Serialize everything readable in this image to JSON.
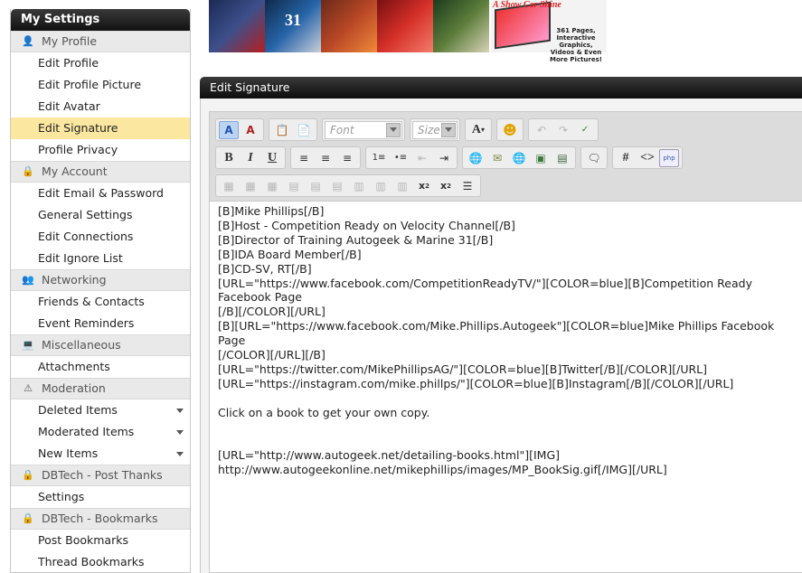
{
  "sidebar": {
    "title": "My Settings",
    "sections": [
      {
        "label": "My Profile",
        "icon": "user-icon",
        "items": [
          {
            "label": "Edit Profile"
          },
          {
            "label": "Edit Profile Picture"
          },
          {
            "label": "Edit Avatar"
          },
          {
            "label": "Edit Signature",
            "active": true
          },
          {
            "label": "Profile Privacy"
          }
        ]
      },
      {
        "label": "My Account",
        "icon": "lock-icon",
        "items": [
          {
            "label": "Edit Email & Password"
          },
          {
            "label": "General Settings"
          },
          {
            "label": "Edit Connections"
          },
          {
            "label": "Edit Ignore List"
          }
        ]
      },
      {
        "label": "Networking",
        "icon": "people-icon",
        "items": [
          {
            "label": "Friends & Contacts"
          },
          {
            "label": "Event Reminders"
          }
        ]
      },
      {
        "label": "Miscellaneous",
        "icon": "monitor-icon",
        "items": [
          {
            "label": "Attachments"
          }
        ]
      },
      {
        "label": "Moderation",
        "icon": "warning-icon",
        "items": [
          {
            "label": "Deleted Items",
            "dropdown": true
          },
          {
            "label": "Moderated Items",
            "dropdown": true
          },
          {
            "label": "New Items",
            "dropdown": true
          }
        ]
      },
      {
        "label": "DBTech - Post Thanks",
        "icon": "lock-icon",
        "items": [
          {
            "label": "Settings"
          }
        ]
      },
      {
        "label": "DBTech - Bookmarks",
        "icon": "lock-icon",
        "items": [
          {
            "label": "Post Bookmarks"
          },
          {
            "label": "Thread Bookmarks"
          }
        ]
      }
    ]
  },
  "banner": {
    "thumb_labels": [
      "",
      "31",
      "",
      "",
      ""
    ],
    "tablet_title": "A Show Car Shine",
    "tablet_text": "361 Pages, Interactive Graphics, Videos & Even More Pictures!"
  },
  "panel": {
    "title": "Edit Signature"
  },
  "toolbar": {
    "font_placeholder": "Font",
    "size_placeholder": "Size"
  },
  "signature_text": "[B]Mike Phillips[/B]\n[B]Host - Competition Ready on Velocity Channel[/B]\n[B]Director of Training Autogeek & Marine 31[/B]\n[B]IDA Board Member[/B]\n[B]CD-SV, RT[/B]\n[URL=\"https://www.facebook.com/CompetitionReadyTV/\"][COLOR=blue][B]Competition Ready Facebook Page\n[/B][/COLOR][/URL]\n[B][URL=\"https://www.facebook.com/Mike.Phillips.Autogeek\"][COLOR=blue]Mike Phillips Facebook Page\n[/COLOR][/URL][/B]\n[URL=\"https://twitter.com/MikePhillipsAG/\"][COLOR=blue][B]Twitter[/B][/COLOR][/URL]\n[URL=\"https://instagram.com/mike.phillps/\"][COLOR=blue][B]Instagram[/B][/COLOR][/URL]\n\nClick on a book to get your own copy.\n\n\n[URL=\"http://www.autogeek.net/detailing-books.html\"][IMG]\nhttp://www.autogeekonline.net/mikephillips/images/MP_BookSig.gif[/IMG][/URL]",
  "colors": {
    "active_item": "#fbe7a0",
    "header_dark": "#111111",
    "toolbar_bg": "#dcdcdc"
  }
}
